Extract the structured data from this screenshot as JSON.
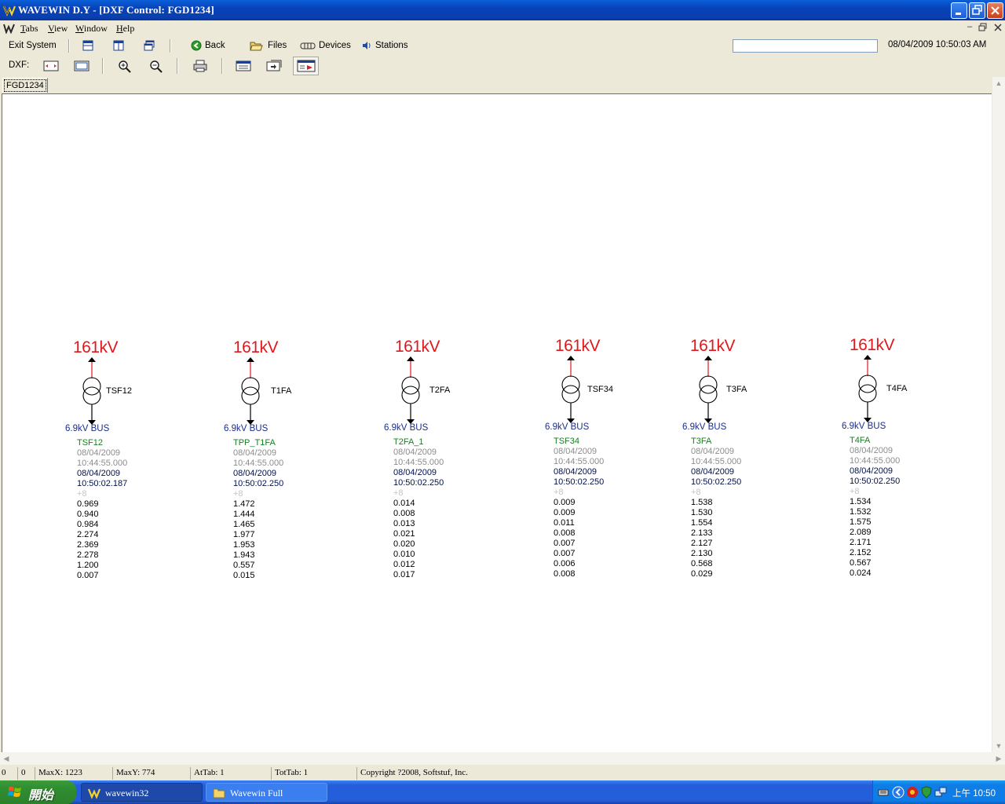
{
  "window": {
    "title": "WAVEWIN D.Y - [DXF Control:  FGD1234]"
  },
  "menu": [
    "Tabs",
    "View",
    "Window",
    "Help"
  ],
  "menu_accel": [
    "T",
    "V",
    "W",
    "H"
  ],
  "toolbar": {
    "exit_label": "Exit System",
    "back_label": "Back",
    "files_label": "Files",
    "devices_label": "Devices",
    "stations_label": "Stations",
    "datetime": "08/04/2009   10:50:03 AM",
    "dxf_label": "DXF:"
  },
  "doc_tab": "FGD1234",
  "diagram": {
    "voltage_label": "161kV",
    "bus_label": "6.9kV BUS",
    "transformers": [
      {
        "name": "TSF12",
        "device": "TSF12",
        "trig_date": "08/04/2009",
        "trig_time": "10:44:55.000",
        "date": "08/04/2009",
        "time": "10:50:02.187",
        "offset": "+8",
        "values": [
          "0.969",
          "0.940",
          "0.984",
          "2.274",
          "2.369",
          "2.278",
          "1.200",
          "0.007"
        ]
      },
      {
        "name": "T1FA",
        "device": "TPP_T1FA",
        "trig_date": "08/04/2009",
        "trig_time": "10:44:55.000",
        "date": "08/04/2009",
        "time": "10:50:02.250",
        "offset": "+8",
        "values": [
          "1.472",
          "1.444",
          "1.465",
          "1.977",
          "1.953",
          "1.943",
          "0.557",
          "0.015"
        ]
      },
      {
        "name": "T2FA",
        "device": "T2FA_1",
        "trig_date": "08/04/2009",
        "trig_time": "10:44:55.000",
        "date": "08/04/2009",
        "time": "10:50:02.250",
        "offset": "+8",
        "values": [
          "0.014",
          "0.008",
          "0.013",
          "0.021",
          "0.020",
          "0.010",
          "0.012",
          "0.017"
        ]
      },
      {
        "name": "TSF34",
        "device": "TSF34",
        "trig_date": "08/04/2009",
        "trig_time": "10:44:55.000",
        "date": "08/04/2009",
        "time": "10:50:02.250",
        "offset": "+8",
        "values": [
          "0.009",
          "0.009",
          "0.011",
          "0.008",
          "0.007",
          "0.007",
          "0.006",
          "0.008"
        ]
      },
      {
        "name": "T3FA",
        "device": "T3FA",
        "trig_date": "08/04/2009",
        "trig_time": "10:44:55.000",
        "date": "08/04/2009",
        "time": "10:50:02.250",
        "offset": "+8",
        "values": [
          "1.538",
          "1.530",
          "1.554",
          "2.133",
          "2.127",
          "2.130",
          "0.568",
          "0.029"
        ]
      },
      {
        "name": "T4FA",
        "device": "T4FA",
        "trig_date": "08/04/2009",
        "trig_time": "10:44:55.000",
        "date": "08/04/2009",
        "time": "10:50:02.250",
        "offset": "+8",
        "values": [
          "1.534",
          "1.532",
          "1.575",
          "2.089",
          "2.171",
          "2.152",
          "0.567",
          "0.024"
        ]
      }
    ]
  },
  "status": {
    "c1": "0",
    "c2": "0",
    "maxx": "MaxX: 1223",
    "maxy": "MaxY: 774",
    "attab": "AtTab: 1",
    "tottab": "TotTab: 1",
    "copyright": "Copyright ?2008, Softstuf, Inc."
  },
  "taskbar": {
    "start_label": "開始",
    "tasks": [
      "wavewin32",
      "Wavewin Full"
    ],
    "clock": "上午 10:50"
  },
  "colors": {
    "voltage": "#e0181c",
    "bus": "#1a2d8c",
    "device_name": "#15801f",
    "title_bar": "#0842b8"
  },
  "icons": {
    "back": "green-back-arrow-icon",
    "files": "folder-open-icon",
    "devices": "device-chain-icon",
    "stations": "speaker-icon"
  }
}
